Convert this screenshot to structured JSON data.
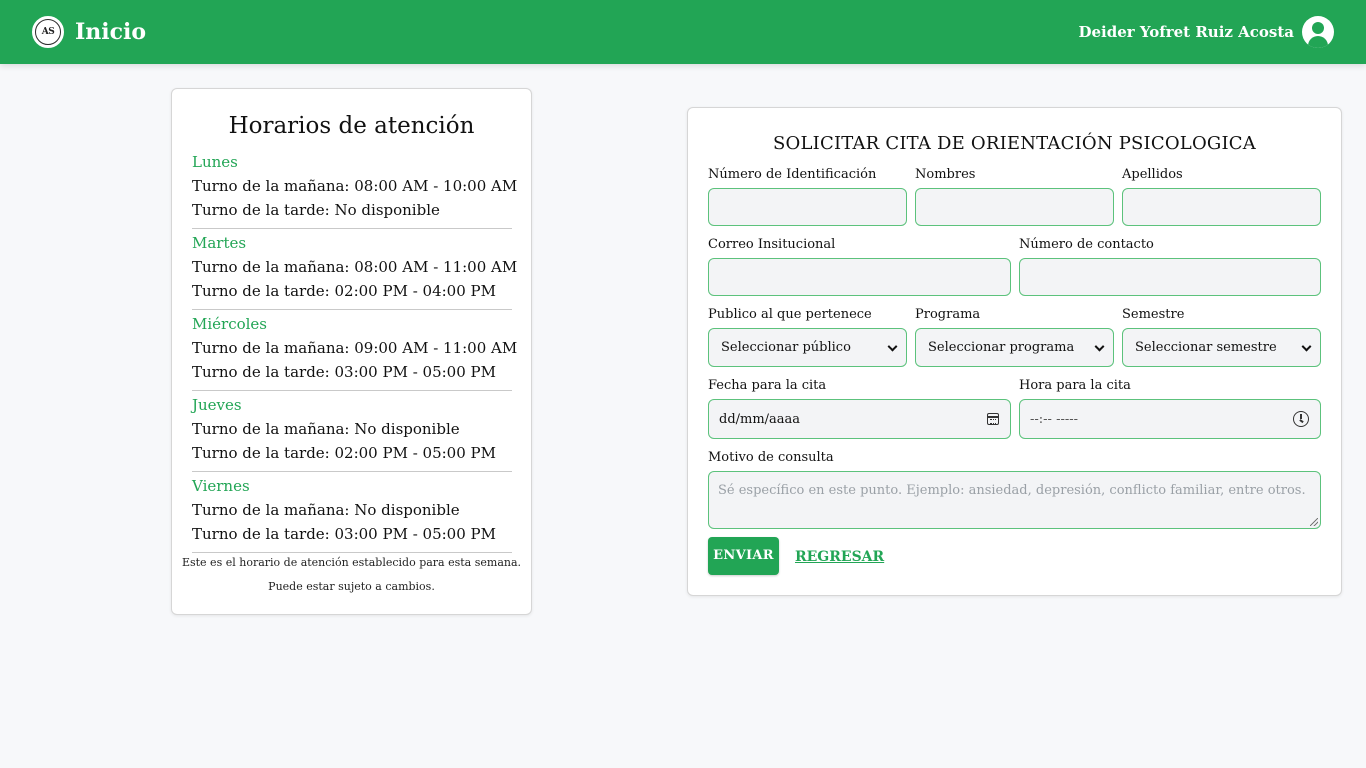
{
  "header": {
    "logo_text": "AS",
    "title": "Inicio",
    "user_name": "Deider Yofret Ruiz Acosta"
  },
  "schedule": {
    "title": "Horarios de atención",
    "days": [
      {
        "name": "Lunes",
        "morning": "Turno de la mañana: 08:00 AM - 10:00 AM",
        "afternoon": "Turno de la tarde: No disponible"
      },
      {
        "name": "Martes",
        "morning": "Turno de la mañana: 08:00 AM - 11:00 AM",
        "afternoon": "Turno de la tarde: 02:00 PM - 04:00 PM"
      },
      {
        "name": "Miércoles",
        "morning": "Turno de la mañana: 09:00 AM - 11:00 AM",
        "afternoon": "Turno de la tarde: 03:00 PM - 05:00 PM"
      },
      {
        "name": "Jueves",
        "morning": "Turno de la mañana: No disponible",
        "afternoon": "Turno de la tarde: 02:00 PM - 05:00 PM"
      },
      {
        "name": "Viernes",
        "morning": "Turno de la mañana: No disponible",
        "afternoon": "Turno de la tarde: 03:00 PM - 05:00 PM"
      }
    ],
    "note_line1": "Este es el horario de atención establecido para esta semana.",
    "note_line2": "Puede estar sujeto a cambios."
  },
  "form": {
    "title": "SOLICITAR CITA DE ORIENTACIÓN PSICOLOGICA",
    "labels": {
      "id_number": "Número de Identificación",
      "first_names": "Nombres",
      "last_names": "Apellidos",
      "email": "Correo Insitucional",
      "phone": "Número de contacto",
      "audience": "Publico al que pertenece",
      "program": "Programa",
      "semester": "Semestre",
      "date": "Fecha para la cita",
      "time": "Hora para la cita",
      "reason": "Motivo de consulta"
    },
    "values": {
      "id_number": "",
      "first_names": "",
      "last_names": "",
      "email": "",
      "phone": ""
    },
    "selects": {
      "audience": "Seleccionar público",
      "program": "Seleccionar programa",
      "semester": "Seleccionar semestre"
    },
    "date_placeholder": "dd/mm/aaaa",
    "time_placeholder": "--:-- -----",
    "reason_placeholder": "Sé específico en este punto. Ejemplo: ansiedad, depresión, conflicto familiar, entre otros.",
    "submit_label": "ENVIAR",
    "back_label": "REGRESAR"
  },
  "colors": {
    "primary": "#22a555",
    "field_border": "#5cc27c",
    "field_bg": "#f3f4f6",
    "page_bg": "#f7f8fa"
  },
  "icons": [
    "logo-icon",
    "user-avatar-icon",
    "calendar-icon",
    "clock-icon",
    "chevron-down-icon"
  ]
}
